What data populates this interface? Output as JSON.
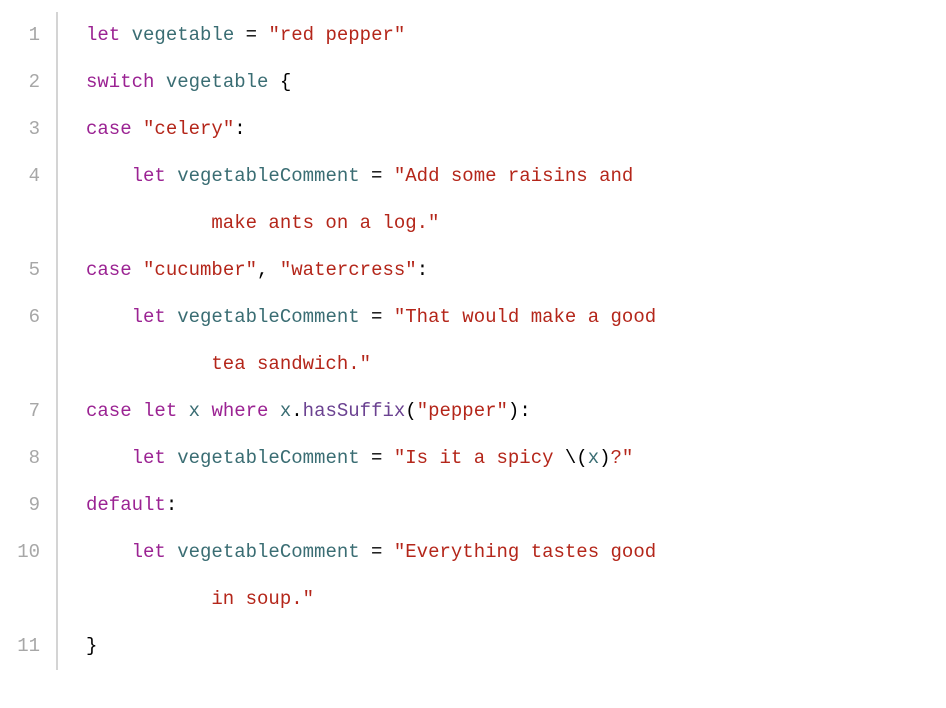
{
  "colors": {
    "keyword": "#9b2393",
    "identifier": "#3a6d73",
    "string": "#b4261a",
    "method": "#6b4291",
    "punctuation": "#000000",
    "gutter": "#a7a7a7"
  },
  "gutter": [
    "1",
    "2",
    "3",
    "4",
    "5",
    "6",
    "7",
    "8",
    "9",
    "10",
    "11"
  ],
  "lines": [
    {
      "segments": [
        {
          "t": "let ",
          "c": "kw"
        },
        {
          "t": "vegetable",
          "c": "def"
        },
        {
          "t": " = ",
          "c": "punc"
        },
        {
          "t": "\"red pepper\"",
          "c": "str"
        }
      ]
    },
    {
      "segments": [
        {
          "t": "switch ",
          "c": "kw"
        },
        {
          "t": "vegetable",
          "c": "def"
        },
        {
          "t": " {",
          "c": "punc"
        }
      ]
    },
    {
      "segments": [
        {
          "t": "case ",
          "c": "kw"
        },
        {
          "t": "\"celery\"",
          "c": "str"
        },
        {
          "t": ":",
          "c": "punc"
        }
      ]
    },
    {
      "segments": [
        {
          "t": "    ",
          "c": "plain"
        },
        {
          "t": "let ",
          "c": "kw"
        },
        {
          "t": "vegetableComment",
          "c": "def"
        },
        {
          "t": " = ",
          "c": "punc"
        },
        {
          "t": "\"Add some raisins and",
          "c": "str"
        }
      ],
      "wrap": [
        {
          "t": "make ants on a log.\"",
          "c": "str"
        }
      ]
    },
    {
      "segments": [
        {
          "t": "case ",
          "c": "kw"
        },
        {
          "t": "\"cucumber\"",
          "c": "str"
        },
        {
          "t": ", ",
          "c": "punc"
        },
        {
          "t": "\"watercress\"",
          "c": "str"
        },
        {
          "t": ":",
          "c": "punc"
        }
      ]
    },
    {
      "segments": [
        {
          "t": "    ",
          "c": "plain"
        },
        {
          "t": "let ",
          "c": "kw"
        },
        {
          "t": "vegetableComment",
          "c": "def"
        },
        {
          "t": " = ",
          "c": "punc"
        },
        {
          "t": "\"That would make a good",
          "c": "str"
        }
      ],
      "wrap": [
        {
          "t": "tea sandwich.\"",
          "c": "str"
        }
      ]
    },
    {
      "segments": [
        {
          "t": "case ",
          "c": "kw"
        },
        {
          "t": "let ",
          "c": "kw"
        },
        {
          "t": "x",
          "c": "def"
        },
        {
          "t": " ",
          "c": "plain"
        },
        {
          "t": "where ",
          "c": "kw"
        },
        {
          "t": "x",
          "c": "def"
        },
        {
          "t": ".",
          "c": "punc"
        },
        {
          "t": "hasSuffix",
          "c": "call"
        },
        {
          "t": "(",
          "c": "punc"
        },
        {
          "t": "\"pepper\"",
          "c": "str"
        },
        {
          "t": "):",
          "c": "punc"
        }
      ]
    },
    {
      "segments": [
        {
          "t": "    ",
          "c": "plain"
        },
        {
          "t": "let ",
          "c": "kw"
        },
        {
          "t": "vegetableComment",
          "c": "def"
        },
        {
          "t": " = ",
          "c": "punc"
        },
        {
          "t": "\"Is it a spicy ",
          "c": "str"
        },
        {
          "t": "\\(",
          "c": "punc"
        },
        {
          "t": "x",
          "c": "def"
        },
        {
          "t": ")",
          "c": "punc"
        },
        {
          "t": "?\"",
          "c": "str"
        }
      ]
    },
    {
      "segments": [
        {
          "t": "default",
          "c": "kw"
        },
        {
          "t": ":",
          "c": "punc"
        }
      ]
    },
    {
      "segments": [
        {
          "t": "    ",
          "c": "plain"
        },
        {
          "t": "let ",
          "c": "kw"
        },
        {
          "t": "vegetableComment",
          "c": "def"
        },
        {
          "t": " = ",
          "c": "punc"
        },
        {
          "t": "\"Everything tastes good",
          "c": "str"
        }
      ],
      "wrap": [
        {
          "t": "in soup.\"",
          "c": "str"
        }
      ]
    },
    {
      "segments": [
        {
          "t": "}",
          "c": "punc"
        }
      ]
    }
  ]
}
